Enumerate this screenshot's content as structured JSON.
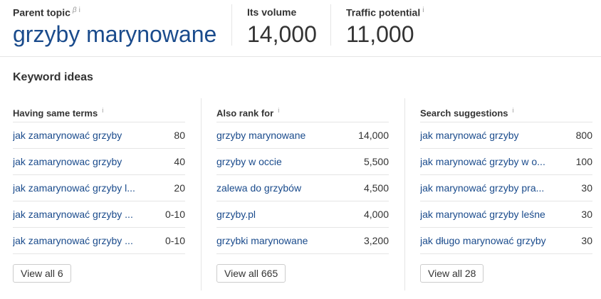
{
  "header": {
    "parent_topic": {
      "label": "Parent topic",
      "beta": "β",
      "info": "i",
      "value": "grzyby marynowane"
    },
    "volume": {
      "label": "Its volume",
      "value": "14,000"
    },
    "traffic": {
      "label": "Traffic potential",
      "info": "i",
      "value": "11,000"
    }
  },
  "section_title": "Keyword ideas",
  "columns": [
    {
      "title": "Having same terms",
      "info": "i",
      "rows": [
        {
          "keyword": "jak zamarynować grzyby",
          "value": "80"
        },
        {
          "keyword": "jak zamarynowac grzyby",
          "value": "40"
        },
        {
          "keyword": "jak zamarynować grzyby l...",
          "value": "20"
        },
        {
          "keyword": "jak zamarynować grzyby ...",
          "value": "0-10"
        },
        {
          "keyword": "jak zamarynować grzyby ...",
          "value": "0-10"
        }
      ],
      "view_all": "View all 6"
    },
    {
      "title": "Also rank for",
      "info": "i",
      "rows": [
        {
          "keyword": "grzyby marynowane",
          "value": "14,000"
        },
        {
          "keyword": "grzyby w occie",
          "value": "5,500"
        },
        {
          "keyword": "zalewa do grzybów",
          "value": "4,500"
        },
        {
          "keyword": "grzyby.pl",
          "value": "4,000"
        },
        {
          "keyword": "grzybki marynowane",
          "value": "3,200"
        }
      ],
      "view_all": "View all 665"
    },
    {
      "title": "Search suggestions",
      "info": "i",
      "rows": [
        {
          "keyword": "jak marynować grzyby",
          "value": "800"
        },
        {
          "keyword": "jak marynować grzyby w o...",
          "value": "100"
        },
        {
          "keyword": "jak marynować grzyby pra...",
          "value": "30"
        },
        {
          "keyword": "jak marynować grzyby leśne",
          "value": "30"
        },
        {
          "keyword": "jak długo marynować grzyby",
          "value": "30"
        }
      ],
      "view_all": "View all 28"
    }
  ]
}
